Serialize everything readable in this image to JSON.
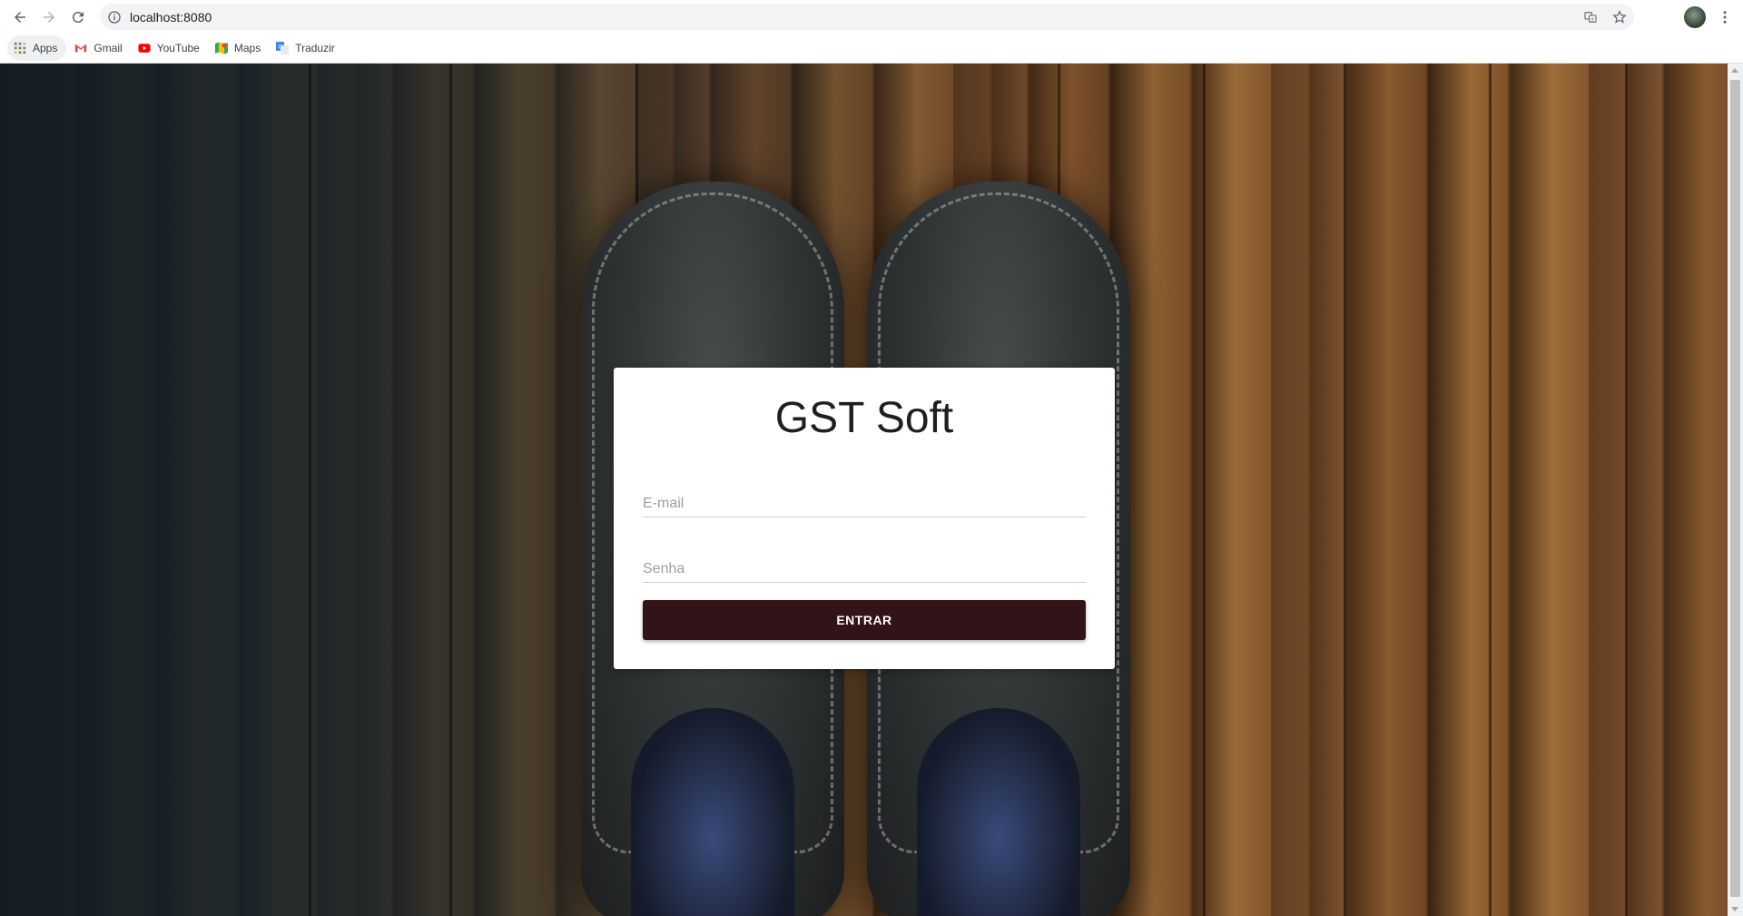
{
  "browser": {
    "url": "localhost:8080",
    "icons": {
      "back": "arrow-left-icon",
      "forward": "arrow-right-icon",
      "reload": "reload-icon",
      "site_info": "info-icon",
      "translate": "translate-icon",
      "bookmark": "star-icon",
      "profile": "avatar",
      "menu": "more-vert-icon"
    }
  },
  "bookmarks": [
    {
      "label": "Apps",
      "icon": "apps-grid-icon"
    },
    {
      "label": "Gmail",
      "icon": "gmail-icon"
    },
    {
      "label": "YouTube",
      "icon": "youtube-icon"
    },
    {
      "label": "Maps",
      "icon": "maps-icon"
    },
    {
      "label": "Traduzir",
      "icon": "translate-icon"
    }
  ],
  "login": {
    "title": "GST Soft",
    "email_placeholder": "E-mail",
    "email_value": "",
    "password_placeholder": "Senha",
    "password_value": "",
    "submit_label": "ENTRAR"
  },
  "colors": {
    "button_bg": "#311318",
    "card_bg": "#ffffff"
  }
}
